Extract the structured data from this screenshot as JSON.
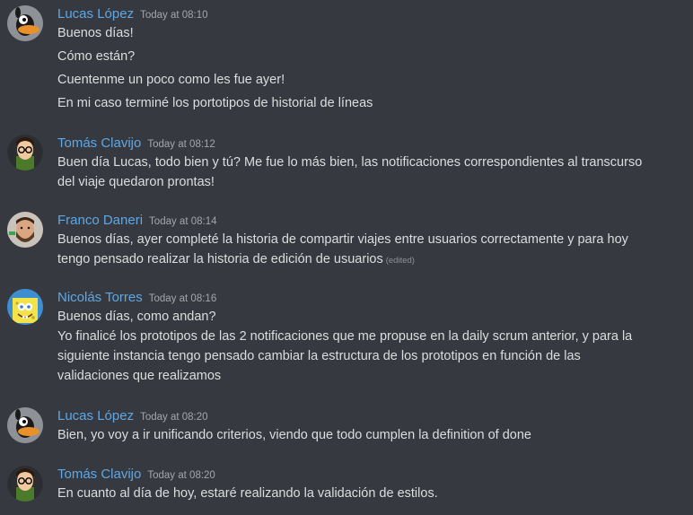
{
  "messages": [
    {
      "author": "Lucas López",
      "avatar": "daffy-duck-avatar",
      "time": "Today at 08:10",
      "lines": [
        "Buenos días!",
        "Cómo están?",
        "Cuentenme un poco como les fue ayer!",
        "En mi caso terminé los portotipos de historial de líneas"
      ]
    },
    {
      "author": "Tomás Clavijo",
      "avatar": "cartoon-glasses-avatar",
      "time": "Today at 08:12",
      "lines": [
        "Buen día Lucas, todo bien y tú? Me fue lo más bien, las notificaciones correspondientes al transcurso",
        "del viaje quedaron prontas!"
      ]
    },
    {
      "author": "Franco Daneri",
      "avatar": "bearded-man-avatar",
      "time": "Today at 08:14",
      "lines": [
        "Buenos días, ayer completé la historia de compartir viajes entre usuarios correctamente y para hoy",
        "tengo pensado realizar la historia de edición de usuarios"
      ],
      "edited": "(edited)"
    },
    {
      "author": "Nicolás Torres",
      "avatar": "spongebob-avatar",
      "time": "Today at 08:16",
      "lines": [
        "Buenos días, como andan?",
        "Yo finalicé los prototipos de las 2 notificaciones que me propuse en la daily scrum anterior, y para la",
        "siguiente instancia tengo pensado cambiar la estructura de los prototipos en función de las",
        "validaciones que realizamos"
      ]
    },
    {
      "author": "Lucas López",
      "avatar": "daffy-duck-avatar",
      "time": "Today at 08:20",
      "lines": [
        "Bien, yo voy a ir unificando criterios, viendo que todo cumplen la definition of done"
      ]
    },
    {
      "author": "Tomás Clavijo",
      "avatar": "cartoon-glasses-avatar",
      "time": "Today at 08:20",
      "lines": [
        "En cuanto al día de hoy, estaré realizando la validación de estilos."
      ]
    }
  ],
  "colors": {
    "background": "#36393f",
    "username": "#5ea8e6",
    "text": "#dcddde",
    "timestamp": "#a3a6aa"
  }
}
